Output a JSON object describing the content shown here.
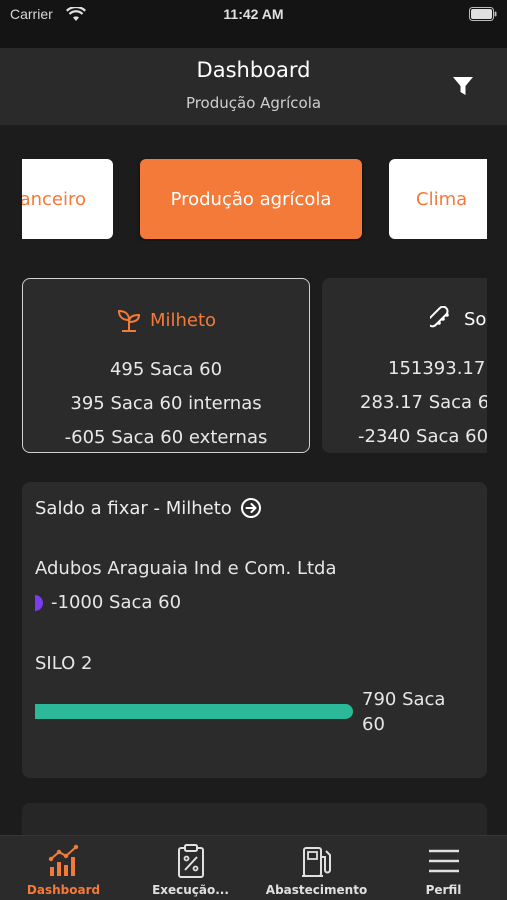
{
  "status_bar": {
    "carrier": "Carrier",
    "time": "11:42 AM"
  },
  "header": {
    "title": "Dashboard",
    "subtitle": "Produção Agrícola",
    "filter_icon": "filter-icon"
  },
  "tabs": [
    {
      "label": "anceiro",
      "active": false
    },
    {
      "label": "Produção agrícola",
      "active": true
    },
    {
      "label": "Clima",
      "active": false
    }
  ],
  "crops": [
    {
      "name": "Milheto",
      "icon": "sprout-icon",
      "selected": true,
      "lines": [
        "495 Saca 60",
        "395 Saca 60 internas",
        "-605 Saca 60 externas"
      ]
    },
    {
      "name": "So",
      "icon": "soybean-icon",
      "selected": false,
      "lines": [
        "151393.17 S",
        "283.17 Saca 6",
        "-2340 Saca 60"
      ]
    }
  ],
  "saldo": {
    "title": "Saldo a fixar - Milheto",
    "arrow_icon": "arrow-circle-right-icon",
    "company": "Adubos Araguaia Ind e Com. Ltda",
    "company_value": "-1000 Saca 60",
    "silo_label": "SILO 2",
    "silo_value_line1": "790 Saca",
    "silo_value_line2": "60",
    "silo_fill_fraction": 1.0
  },
  "bottom_nav": [
    {
      "label": "Dashboard",
      "icon": "chart-icon",
      "active": true
    },
    {
      "label": "Execução...",
      "icon": "clipboard-percent-icon",
      "active": false
    },
    {
      "label": "Abastecimento",
      "icon": "fuel-pump-icon",
      "active": false
    },
    {
      "label": "Perfil",
      "icon": "menu-icon",
      "active": false
    }
  ],
  "colors": {
    "accent": "#f47a3a",
    "bar": "#2bb99a",
    "card": "#2b2b2b",
    "background": "#1c1c1c",
    "dot": "#7b3cf0"
  }
}
